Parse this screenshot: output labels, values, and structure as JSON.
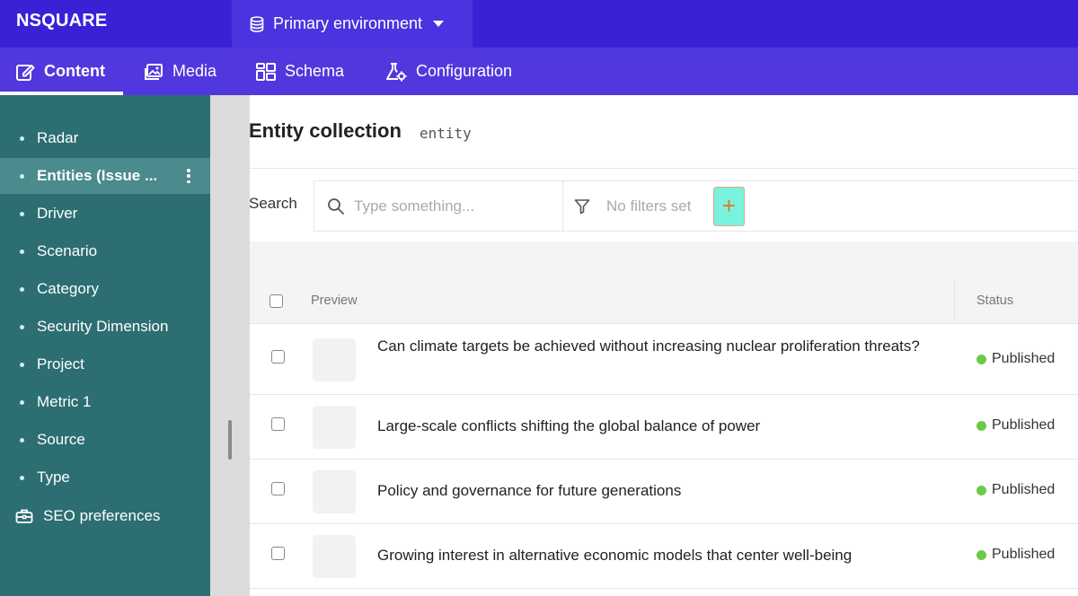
{
  "app": {
    "brand": "NSQUARE",
    "environment": "Primary environment"
  },
  "nav": {
    "tabs": [
      {
        "label": "Content",
        "icon": "edit-icon",
        "active": true
      },
      {
        "label": "Media",
        "icon": "image-icon"
      },
      {
        "label": "Schema",
        "icon": "schema-icon"
      },
      {
        "label": "Configuration",
        "icon": "flask-gear-icon"
      }
    ]
  },
  "sidebar": {
    "items": [
      {
        "label": "Radar"
      },
      {
        "label": "Entities (Issue ...",
        "active": true
      },
      {
        "label": "Driver"
      },
      {
        "label": "Scenario"
      },
      {
        "label": "Category"
      },
      {
        "label": "Security Dimension"
      },
      {
        "label": "Project"
      },
      {
        "label": "Metric 1"
      },
      {
        "label": "Source"
      },
      {
        "label": "Type"
      }
    ],
    "seo": {
      "label": "SEO preferences",
      "icon": "toolbox-icon"
    }
  },
  "main": {
    "title": "Entity collection",
    "api_id": "entity",
    "search": {
      "label": "Search",
      "placeholder": "Type something..."
    },
    "filters": {
      "label": "No filters set",
      "add_symbol": "+"
    },
    "table": {
      "columns": {
        "preview": "Preview",
        "status": "Status"
      },
      "rows": [
        {
          "title": "Can climate targets be achieved without increasing nuclear proliferation threats?",
          "status": "Published"
        },
        {
          "title": "Large-scale conflicts shifting the global balance of power",
          "status": "Published"
        },
        {
          "title": "Policy and governance for future generations",
          "status": "Published"
        },
        {
          "title": "Growing interest in alternative economic models that center well-being",
          "status": "Published"
        }
      ]
    }
  },
  "colors": {
    "topbar": "#3b21d6",
    "tabsbar": "#5038de",
    "sidebar": "#2c6e72",
    "sidebar_active": "#4b8a8d",
    "published_dot": "#6cc94a",
    "add_filter_bg": "#7af2e0"
  }
}
